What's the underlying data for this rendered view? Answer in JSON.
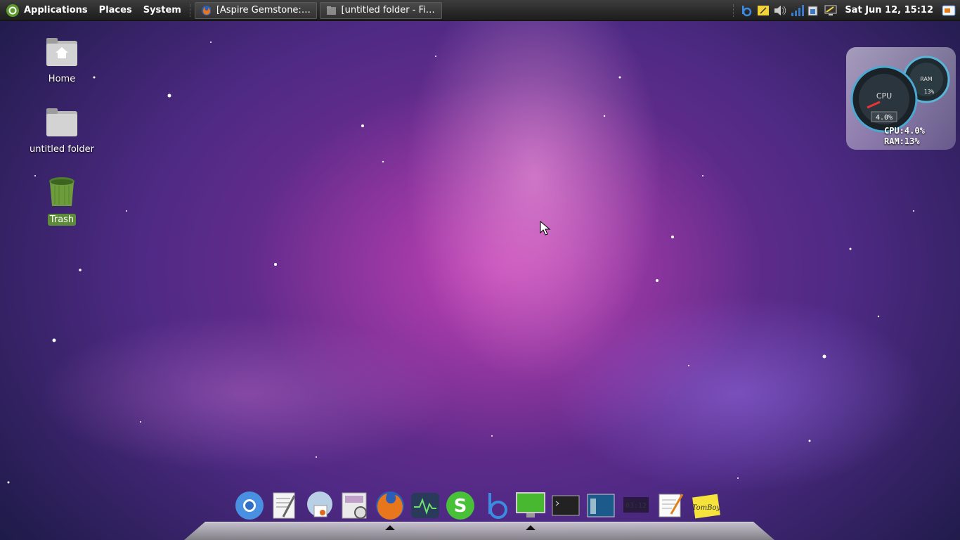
{
  "panel": {
    "menus": [
      "Applications",
      "Places",
      "System"
    ],
    "tasks": [
      {
        "label": "[Aspire Gemstone: Ac...",
        "icon": "firefox-icon"
      },
      {
        "label": "[untitled folder - File B...",
        "icon": "folder-icon"
      }
    ],
    "clock": "Sat Jun 12, 15:12"
  },
  "desktop": {
    "icons": [
      {
        "label": "Home"
      },
      {
        "label": "untitled folder"
      },
      {
        "label": "Trash"
      }
    ]
  },
  "widget": {
    "cpu_gauge_label": "CPU",
    "cpu_gauge_value": "4.0%",
    "ram_gauge_label": "RAM",
    "ram_gauge_value": "13%",
    "cpu_text": "CPU:4.0%",
    "ram_text": "RAM:13%"
  },
  "dock": {
    "items": [
      "chromium-icon",
      "text-editor-icon",
      "mail-icon",
      "image-viewer-icon",
      "firefox-icon",
      "system-monitor-icon",
      "skype-icon",
      "beatbox-icon",
      "display-icon",
      "terminal-icon",
      "window-icon",
      "clock-icon",
      "notes-icon",
      "tomboy-icon"
    ],
    "tomboy_label": "TomBoy"
  },
  "colors": {
    "selection": "#5d8b3a",
    "panel": "#2a2a2a"
  }
}
